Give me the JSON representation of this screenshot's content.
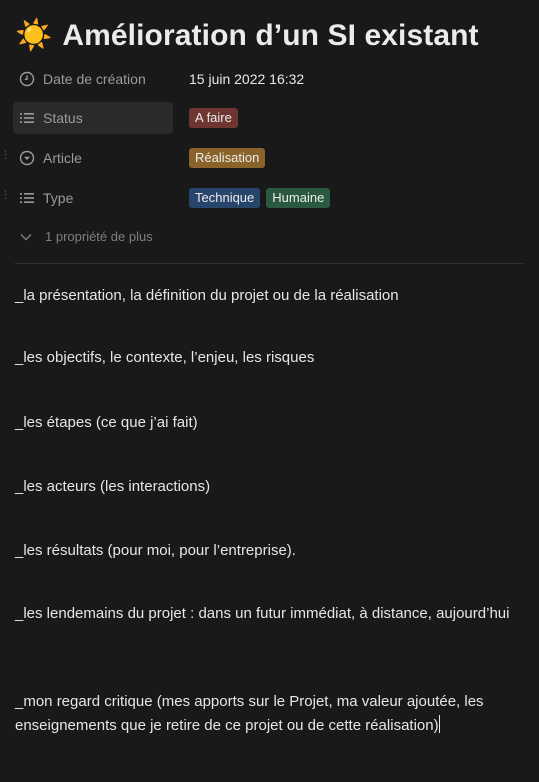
{
  "page": {
    "icon": "sun-icon",
    "title": "Amélioration d’un SI existant"
  },
  "properties": [
    {
      "key": "Date de création",
      "icon": "clock-icon",
      "value": "15 juin 2022 16:32"
    },
    {
      "key": "Status",
      "icon": "list-icon",
      "tags": [
        {
          "label": "A faire",
          "color": "#6e3630"
        }
      ]
    },
    {
      "key": "Article",
      "icon": "circle-chevron-icon",
      "tags": [
        {
          "label": "Réalisation",
          "color": "#89632a"
        }
      ]
    },
    {
      "key": "Type",
      "icon": "list-icon",
      "tags": [
        {
          "label": "Technique",
          "color": "#28456c"
        },
        {
          "label": "Humaine",
          "color": "#2b593f"
        }
      ]
    }
  ],
  "more_properties_label": "1 propriété de plus",
  "paragraphs": [
    "_la présentation, la définition du projet ou de la réalisation",
    "_les objectifs, le contexte, l’enjeu, les risques",
    "_les étapes (ce que j’ai fait)",
    "_les acteurs (les interactions)",
    "_les résultats (pour moi, pour l’entreprise).",
    "_les lendemains du projet : dans un futur immédiat, à distance, aujourd’hui",
    "_mon regard critique (mes apports sur le Projet, ma valeur ajoutée, les enseignements que je retire de ce projet ou de cette réalisation)"
  ]
}
